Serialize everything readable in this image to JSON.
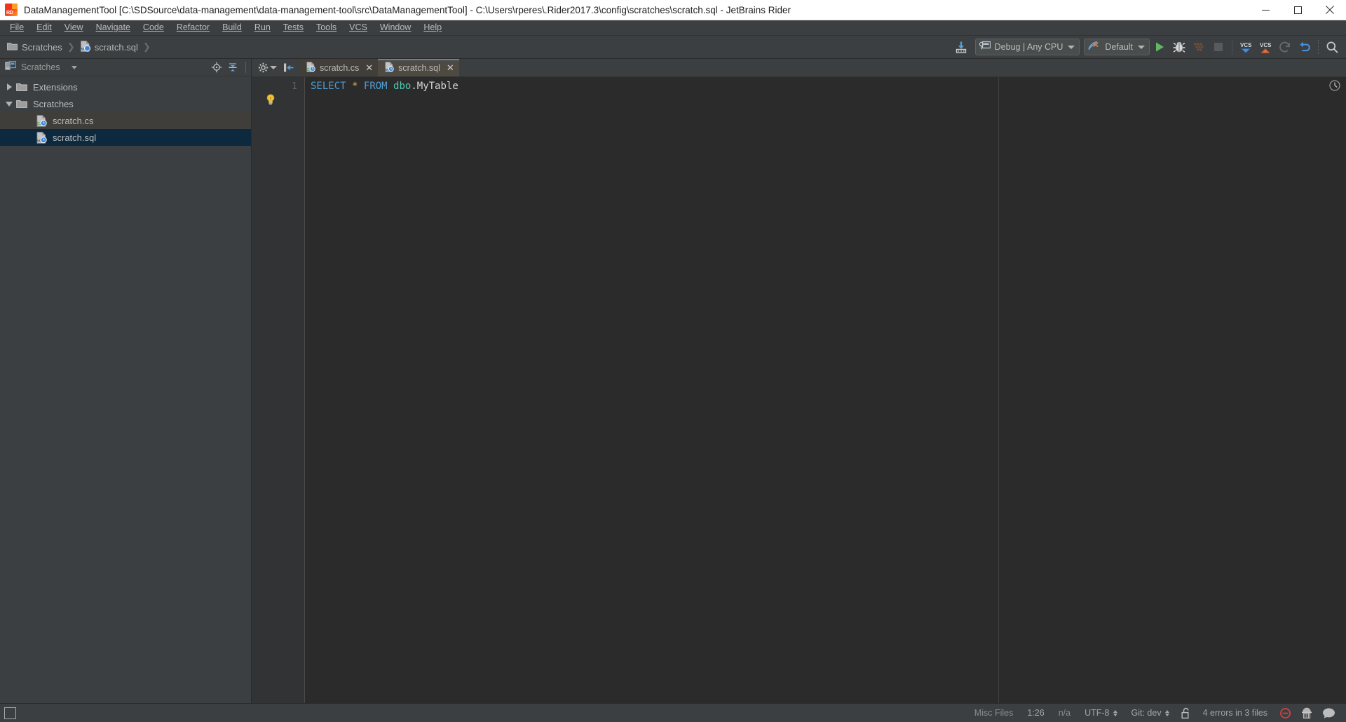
{
  "window": {
    "title": "DataManagementTool [C:\\SDSource\\data-management\\data-management-tool\\src\\DataManagementTool] - C:\\Users\\rperes\\.Rider2017.3\\config\\scratches\\scratch.sql - JetBrains Rider",
    "app_icon": "rider-logo-icon",
    "minimize_label": "Minimize",
    "maximize_label": "Maximize",
    "close_label": "Close"
  },
  "menubar": {
    "items": [
      {
        "label": "File",
        "mnemonic": "F"
      },
      {
        "label": "Edit",
        "mnemonic": "E"
      },
      {
        "label": "View",
        "mnemonic": "V"
      },
      {
        "label": "Navigate",
        "mnemonic": "N"
      },
      {
        "label": "Code",
        "mnemonic": "C"
      },
      {
        "label": "Refactor",
        "mnemonic": "R"
      },
      {
        "label": "Build",
        "mnemonic": "B"
      },
      {
        "label": "Run",
        "mnemonic": "u"
      },
      {
        "label": "Tests",
        "mnemonic": "T"
      },
      {
        "label": "Tools",
        "mnemonic": "o"
      },
      {
        "label": "VCS",
        "mnemonic": "S"
      },
      {
        "label": "Window",
        "mnemonic": "W"
      },
      {
        "label": "Help",
        "mnemonic": "H"
      }
    ]
  },
  "toolbar": {
    "breadcrumb": [
      {
        "label": "Scratches",
        "icon": "folder-icon"
      },
      {
        "label": "scratch.sql",
        "icon": "sql-file-icon"
      }
    ],
    "update_project_label": "Update Project",
    "run_configuration": {
      "label": "Debug | Any CPU",
      "icon": "build-config-icon"
    },
    "run_target": {
      "label": "Default",
      "icon": "run-target-icon"
    },
    "actions": [
      {
        "name": "run-button",
        "label": "Run",
        "enabled": true
      },
      {
        "name": "debug-button",
        "label": "Debug",
        "enabled": true
      },
      {
        "name": "coverage-button",
        "label": "Run with Coverage",
        "enabled": false
      },
      {
        "name": "stop-button",
        "label": "Stop",
        "enabled": false
      },
      {
        "name": "vcs-update-button",
        "label": "VCS Update",
        "enabled": true
      },
      {
        "name": "vcs-commit-button",
        "label": "VCS Commit",
        "enabled": true
      },
      {
        "name": "vcs-rollback-button",
        "label": "Rollback",
        "enabled": false
      },
      {
        "name": "undo-button",
        "label": "Undo",
        "enabled": true
      },
      {
        "name": "search-everywhere-button",
        "label": "Search Everywhere",
        "enabled": true
      }
    ]
  },
  "sidebar": {
    "header": {
      "title": "Scratches",
      "icon": "scratches-panel-icon",
      "locate_label": "Select Opened File",
      "collapse_label": "Collapse All"
    },
    "tree": [
      {
        "label": "Extensions",
        "icon": "folder-icon",
        "expanded": false,
        "depth": 0,
        "state": "normal",
        "twisty": "right"
      },
      {
        "label": "Scratches",
        "icon": "folder-icon",
        "expanded": true,
        "depth": 0,
        "state": "normal",
        "twisty": "down"
      },
      {
        "label": "scratch.cs",
        "icon": "csharp-file-icon",
        "depth": 1,
        "state": "hover",
        "twisty": "none"
      },
      {
        "label": "scratch.sql",
        "icon": "sql-file-icon",
        "depth": 1,
        "state": "selected",
        "twisty": "none"
      }
    ]
  },
  "editor": {
    "tab_tools": {
      "settings_label": "Settings",
      "hide_label": "Hide"
    },
    "tabs": [
      {
        "label": "scratch.cs",
        "icon": "csharp-file-icon",
        "active": false,
        "close": "✕"
      },
      {
        "label": "scratch.sql",
        "icon": "sql-file-icon",
        "active": true,
        "close": "✕"
      }
    ],
    "gutter": {
      "line_numbers": [
        "1"
      ],
      "intention_bulb": "lightbulb-icon"
    },
    "code": {
      "language": "sql",
      "lines": [
        {
          "tokens": [
            {
              "text": "SELECT",
              "type": "keyword"
            },
            {
              "text": " ",
              "type": "plain"
            },
            {
              "text": "*",
              "type": "star"
            },
            {
              "text": " ",
              "type": "plain"
            },
            {
              "text": "FROM",
              "type": "keyword"
            },
            {
              "text": " ",
              "type": "plain"
            },
            {
              "text": "dbo",
              "type": "schema"
            },
            {
              "text": ".MyTable",
              "type": "plain"
            }
          ]
        }
      ],
      "raw": "SELECT * FROM dbo.MyTable"
    },
    "analysis_icon": "inspection-clock-icon"
  },
  "statusbar": {
    "toggle_label": "Show Tool Windows",
    "file_type": "Misc Files",
    "caret_position": "1:26",
    "line_separator": "n/a",
    "encoding": "UTF-8",
    "vcs_branch": "Git: dev",
    "lock_icon": "unlocked-icon",
    "errors": "4 errors in 3 files",
    "error_icon": "error-circle-icon",
    "inspector_icon": "hector-icon",
    "feedback_icon": "feedback-balloon-icon"
  },
  "colors": {
    "chrome_bg": "#3c3f41",
    "editor_bg": "#2b2b2b",
    "gutter_bg": "#313335",
    "selection_blue": "#0d293e",
    "tab_active": "#4e4a42",
    "accent_blue": "#4a88c7",
    "text": "#bbbbbb",
    "keyword": "#4f9fd4",
    "schema": "#4ec9b0",
    "star": "#d6b45a"
  }
}
